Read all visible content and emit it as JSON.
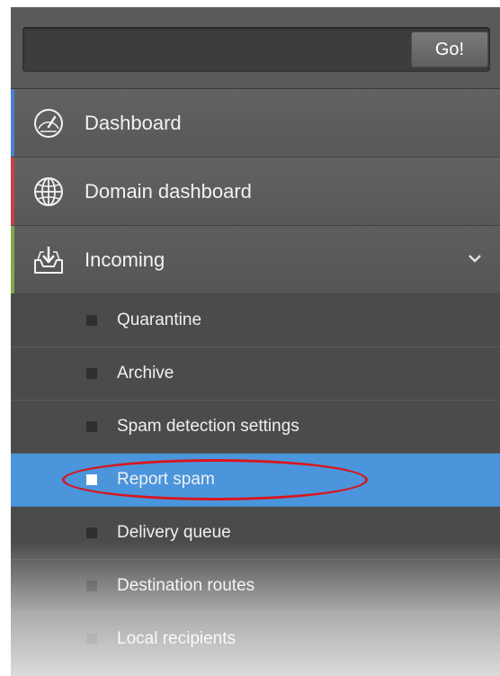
{
  "search": {
    "value": "",
    "placeholder": "",
    "go_label": "Go!"
  },
  "menu": {
    "items": [
      {
        "label": "Dashboard",
        "icon": "gauge-icon",
        "accent": "#4a7fd4"
      },
      {
        "label": "Domain dashboard",
        "icon": "globe-icon",
        "accent": "#c84242"
      },
      {
        "label": "Incoming",
        "icon": "inbox-download-icon",
        "accent": "#7fa84a",
        "expanded": true
      }
    ]
  },
  "submenu": {
    "items": [
      {
        "label": "Quarantine"
      },
      {
        "label": "Archive"
      },
      {
        "label": "Spam detection settings"
      },
      {
        "label": "Report spam",
        "active": true
      },
      {
        "label": "Delivery queue"
      },
      {
        "label": "Destination routes"
      },
      {
        "label": "Local recipients"
      }
    ]
  },
  "colors": {
    "active_item": "#4a95dc",
    "highlight_ellipse": "#d8161c"
  }
}
